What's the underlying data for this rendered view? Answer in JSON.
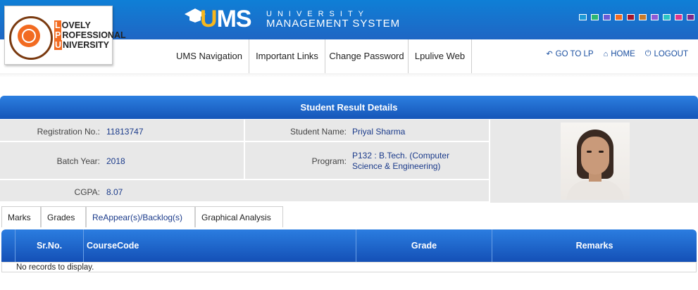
{
  "header": {
    "university_name": {
      "l1": "OVELY",
      "l2": "ROFESSIONAL",
      "l3": "NIVERSITY",
      "c1": "L",
      "c2": "P",
      "c3": "U"
    },
    "seal_text": "LPU",
    "ums_logo": "UMS",
    "ums_sub1": "UNIVERSITY",
    "ums_sub2": "MANAGEMENT SYSTEM",
    "theme_colors": [
      "#1f9ad6",
      "#2bb673",
      "#6b5bd6",
      "#f26b21",
      "#a4152b",
      "#c97b2a",
      "#8e5ad6",
      "#2bc4c4",
      "#e0368a",
      "#7d2a8a"
    ]
  },
  "nav": {
    "items": [
      "UMS Navigation",
      "Important Links",
      "Change Password",
      "Lpulive Web"
    ],
    "go_to_lp": "GO TO LP",
    "home": "HOME",
    "logout": "LOGOUT"
  },
  "panel": {
    "title": "Student Result Details",
    "registration_label": "Registration No.:",
    "registration_value": "11813747",
    "student_name_label": "Student Name:",
    "student_name_value": "Priyal Sharma",
    "batch_label": "Batch Year:",
    "batch_value": "2018",
    "program_label": "Program:",
    "program_value": "P132 : B.Tech. (Computer Science & Engineering)",
    "cgpa_label": "CGPA:",
    "cgpa_value": "8.07"
  },
  "tabs": [
    "Marks",
    "Grades",
    "ReAppear(s)/Backlog(s)",
    "Graphical Analysis"
  ],
  "grid": {
    "columns": [
      "Sr.No.",
      "CourseCode",
      "Grade",
      "Remarks"
    ],
    "empty_message": "No records to display."
  }
}
